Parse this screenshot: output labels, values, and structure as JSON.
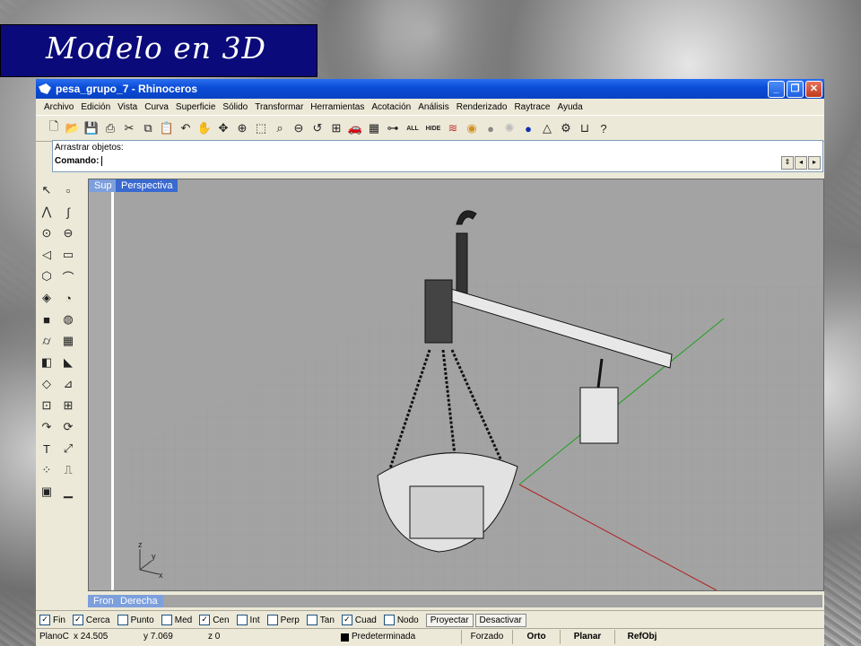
{
  "slide": {
    "title": "Modelo en 3D"
  },
  "window": {
    "title": "pesa_grupo_7 - Rhinoceros"
  },
  "menu": [
    "Archivo",
    "Edición",
    "Vista",
    "Curva",
    "Superficie",
    "Sólido",
    "Transformar",
    "Herramientas",
    "Acotación",
    "Análisis",
    "Renderizado",
    "Raytrace",
    "Ayuda"
  ],
  "toolbar_text": {
    "all": "ALL",
    "hide": "HIDE"
  },
  "command": {
    "line1": "Arrastrar objetos:",
    "prompt": "Comando:"
  },
  "viewports": {
    "top_small": "Sup",
    "main": "Perspectiva",
    "front_small": "Fron",
    "right": "Derecha"
  },
  "axis_labels": {
    "z": "z",
    "y": "y",
    "x": "x"
  },
  "osnaps": [
    {
      "label": "Fin",
      "checked": true
    },
    {
      "label": "Cerca",
      "checked": true
    },
    {
      "label": "Punto",
      "checked": false
    },
    {
      "label": "Med",
      "checked": false
    },
    {
      "label": "Cen",
      "checked": true
    },
    {
      "label": "Int",
      "checked": false
    },
    {
      "label": "Perp",
      "checked": false
    },
    {
      "label": "Tan",
      "checked": false
    },
    {
      "label": "Cuad",
      "checked": true
    },
    {
      "label": "Nodo",
      "checked": false
    }
  ],
  "osnap_buttons": {
    "project": "Proyectar",
    "disable": "Desactivar"
  },
  "statusbar": {
    "plane": "PlanoC",
    "x": "x 24.505",
    "y": "y 7.069",
    "z": "z 0",
    "layer": "Predeterminada",
    "forzado": "Forzado",
    "orto": "Orto",
    "planar": "Planar",
    "refobj": "RefObj"
  },
  "colors": {
    "titlebar": "#0a4bd6",
    "slide_title_bg": "#0a0a7a",
    "viewport_bg": "#a3a3a3",
    "x_axis": "#b02020",
    "y_axis": "#20a020"
  }
}
